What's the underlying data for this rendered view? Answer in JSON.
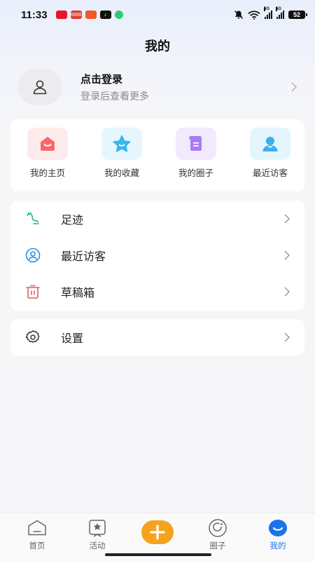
{
  "status_bar": {
    "time": "11:33",
    "battery": "52",
    "signal_tags": [
      "5G",
      "5G"
    ],
    "app_icons": [
      {
        "name": "weibo-icon",
        "color": "#e6162d",
        "text": ""
      },
      {
        "name": "news-app-icon",
        "color": "#e03c31",
        "text": "6666"
      },
      {
        "name": "orange-app-icon",
        "color": "#f05a28",
        "text": ""
      },
      {
        "name": "tiktok-icon",
        "color": "#111111",
        "text": ""
      },
      {
        "name": "shield-app-icon",
        "color": "#2ecc71",
        "text": ""
      }
    ]
  },
  "header": {
    "title": "我的"
  },
  "profile": {
    "login_title": "点击登录",
    "login_subtitle": "登录后查看更多"
  },
  "quick_actions": [
    {
      "label": "我的主页",
      "icon": "home-icon",
      "bg": "#fdebeb",
      "color": "#f46a6a"
    },
    {
      "label": "我的收藏",
      "icon": "star-icon",
      "bg": "#e6f6fd",
      "color": "#3bb5ee"
    },
    {
      "label": "我的圈子",
      "icon": "scroll-icon",
      "bg": "#f1eafd",
      "color": "#a97cf0"
    },
    {
      "label": "最近访客",
      "icon": "visitor-icon",
      "bg": "#e5f5fd",
      "color": "#3bb0ec"
    }
  ],
  "menu": [
    {
      "label": "足迹",
      "icon": "footprint-icon",
      "color": "#1fb97a"
    },
    {
      "label": "最近访客",
      "icon": "user-circle-icon",
      "color": "#2b8fe0"
    },
    {
      "label": "草稿箱",
      "icon": "drafts-icon",
      "color": "#e35d5d"
    }
  ],
  "settings": {
    "label": "设置",
    "icon": "gear-icon"
  },
  "tab_bar": {
    "tabs": [
      {
        "label": "首页",
        "icon": "home-tab-icon",
        "active": false
      },
      {
        "label": "活动",
        "icon": "activity-tab-icon",
        "active": false
      },
      {
        "label": "",
        "icon": "plus-icon",
        "active": false
      },
      {
        "label": "圈子",
        "icon": "circle-tab-icon",
        "active": false
      },
      {
        "label": "我的",
        "icon": "mine-tab-icon",
        "active": true
      }
    ],
    "accent": "#1a73e8",
    "plus_color": "#f5a31c"
  }
}
